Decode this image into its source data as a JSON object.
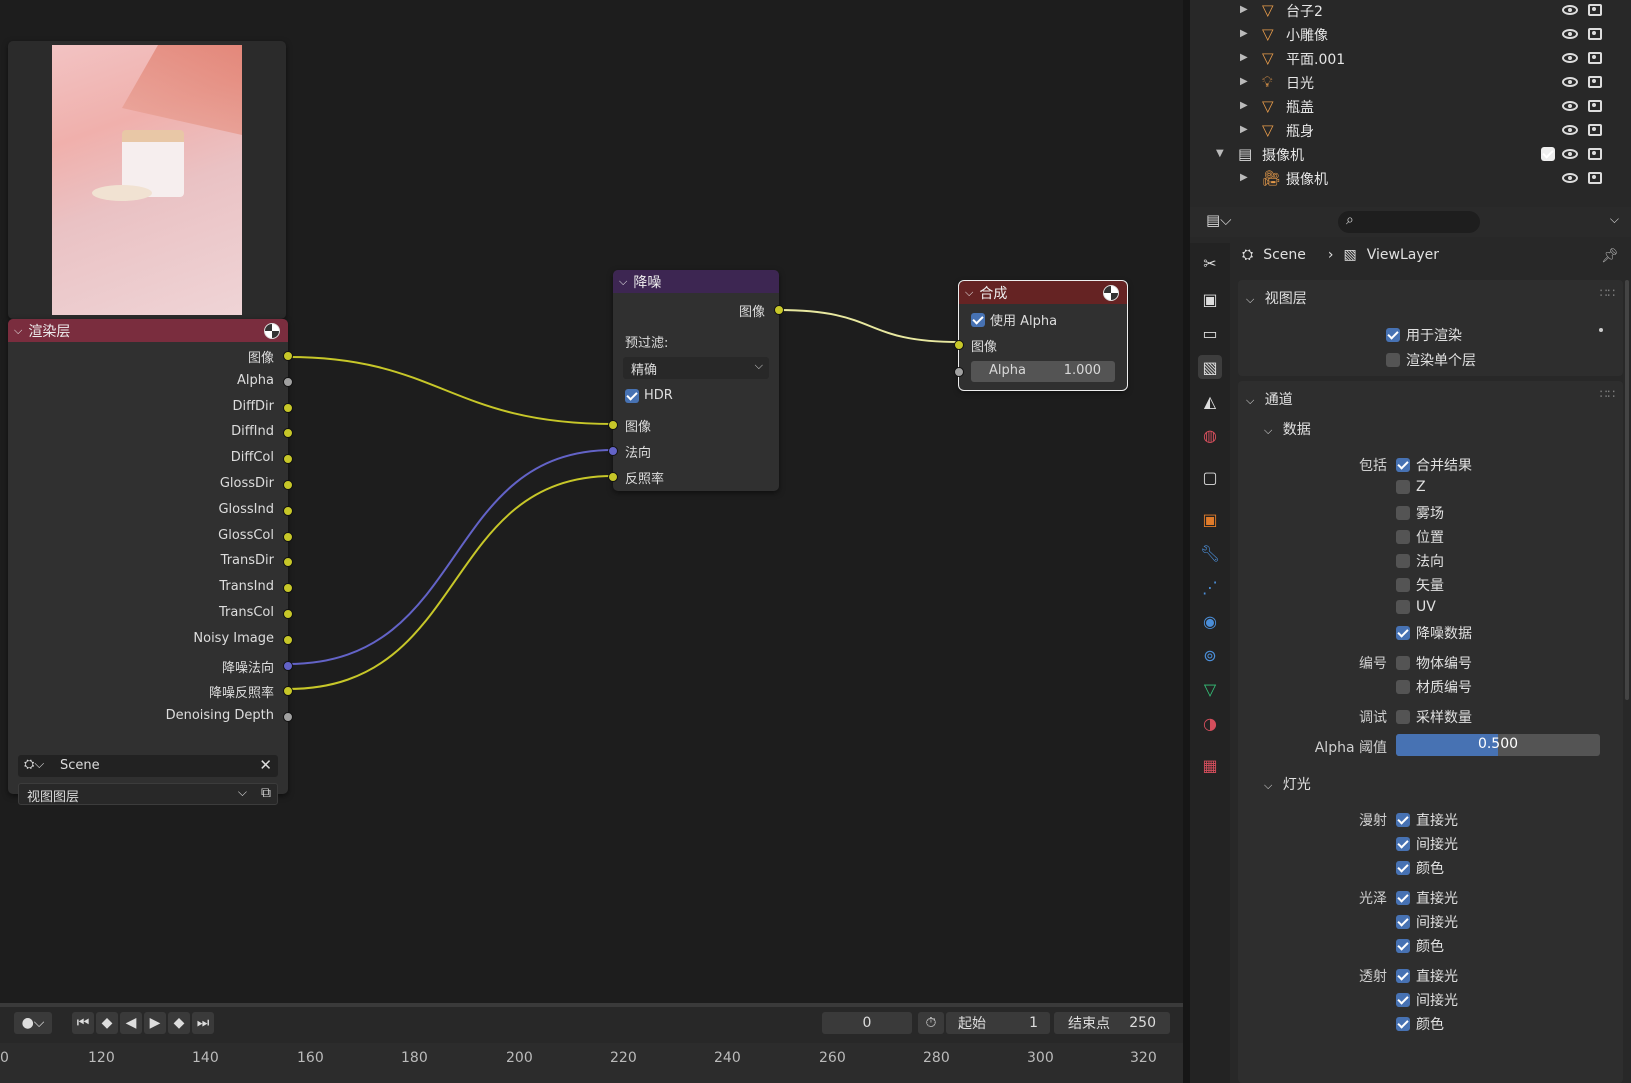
{
  "node_editor": {
    "render_layers_node": {
      "title": "渲染层",
      "outputs": [
        "图像",
        "Alpha",
        "DiffDir",
        "DiffInd",
        "DiffCol",
        "GlossDir",
        "GlossInd",
        "GlossCol",
        "TransDir",
        "TransInd",
        "TransCol",
        "Noisy Image",
        "降噪法向",
        "降噪反照率",
        "Denoising Depth"
      ],
      "scene_value": "Scene",
      "layer_value": "视图图层"
    },
    "denoise_node": {
      "title": "降噪",
      "output_image": "图像",
      "prefilter_label": "预过滤:",
      "prefilter_value": "精确",
      "hdr_label": "HDR",
      "inputs": [
        "图像",
        "法向",
        "反照率"
      ]
    },
    "composite_node": {
      "title": "合成",
      "use_alpha_label": "使用 Alpha",
      "input_image": "图像",
      "alpha_label": "Alpha",
      "alpha_value": "1.000"
    }
  },
  "outliner": {
    "rows": [
      {
        "name": "台子2"
      },
      {
        "name": "小雕像"
      },
      {
        "name": "平面.001"
      },
      {
        "name": "日光"
      },
      {
        "name": "瓶盖"
      },
      {
        "name": "瓶身"
      },
      {
        "name": "摄像机"
      },
      {
        "name": "摄像机"
      }
    ]
  },
  "properties": {
    "breadcrumb_scene": "Scene",
    "breadcrumb_layer": "ViewLayer",
    "view_layer_panel": {
      "title": "视图层",
      "use_for_render": "用于渲染",
      "render_single_layer": "渲染单个层"
    },
    "passes_panel": {
      "title": "通道",
      "data_title": "数据",
      "include_label": "包括",
      "combined": "合并结果",
      "z": "Z",
      "mist": "雾场",
      "position": "位置",
      "normal": "法向",
      "vector": "矢量",
      "uv": "UV",
      "denoising_data": "降噪数据",
      "index_label": "编号",
      "object_index": "物体编号",
      "material_index": "材质编号",
      "debug_label": "调试",
      "sample_count": "采样数量",
      "alpha_threshold_label": "Alpha 阈值",
      "alpha_threshold_value": "0.500",
      "light_title": "灯光",
      "diffuse_label": "漫射",
      "glossy_label": "光泽",
      "transmission_label": "透射",
      "direct": "直接光",
      "indirect": "间接光",
      "color": "颜色"
    }
  },
  "timeline": {
    "current_frame": "0",
    "start_label": "起始",
    "start_value": "1",
    "end_label": "结束点",
    "end_value": "250",
    "ticks": [
      "0",
      "120",
      "140",
      "160",
      "180",
      "200",
      "220",
      "240",
      "260",
      "280",
      "300",
      "320"
    ]
  },
  "colors": {
    "render_layers_header": "#7a2d3e",
    "denoise_header": "#3d2652",
    "composite_header": "#652323",
    "accent_blue": "#4772b3",
    "link_yellow": "#c7c729",
    "link_purple": "#6363c7"
  }
}
